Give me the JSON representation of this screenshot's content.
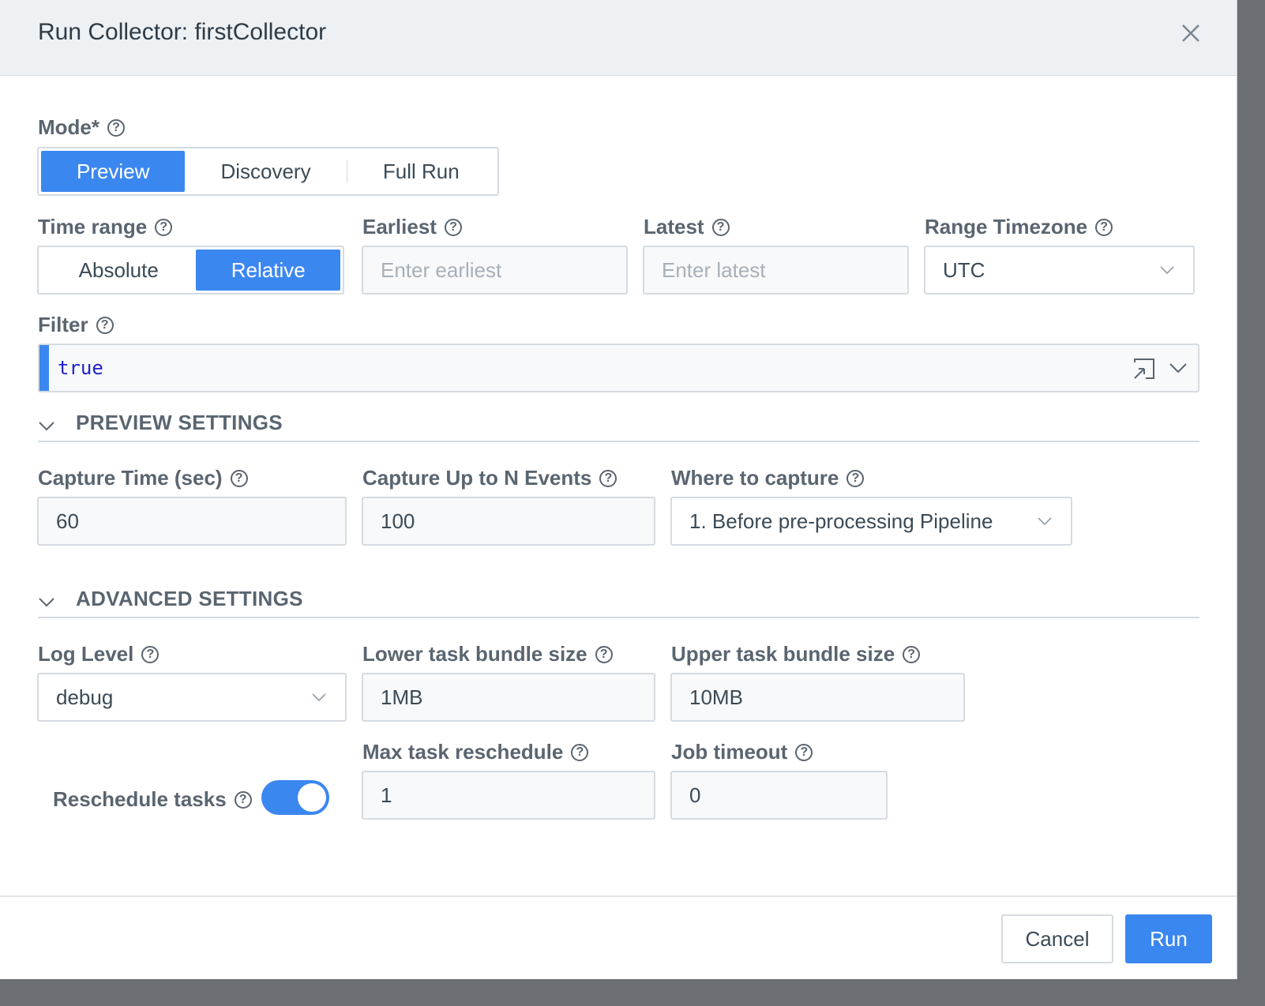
{
  "modal": {
    "title": "Run Collector: firstCollector"
  },
  "mode": {
    "label": "Mode*",
    "options": [
      "Preview",
      "Discovery",
      "Full Run"
    ],
    "selected": "Preview"
  },
  "time_range": {
    "label": "Time range",
    "options": [
      "Absolute",
      "Relative"
    ],
    "selected": "Relative"
  },
  "earliest": {
    "label": "Earliest",
    "placeholder": "Enter earliest",
    "value": ""
  },
  "latest": {
    "label": "Latest",
    "placeholder": "Enter latest",
    "value": ""
  },
  "range_timezone": {
    "label": "Range Timezone",
    "value": "UTC"
  },
  "filter": {
    "label": "Filter",
    "value": "true"
  },
  "preview_settings": {
    "title": "PREVIEW SETTINGS",
    "capture_time": {
      "label": "Capture Time (sec)",
      "value": "60"
    },
    "capture_events": {
      "label": "Capture Up to N Events",
      "value": "100"
    },
    "where_to_capture": {
      "label": "Where to capture",
      "value": "1. Before pre-processing Pipeline"
    }
  },
  "advanced_settings": {
    "title": "ADVANCED SETTINGS",
    "log_level": {
      "label": "Log Level",
      "value": "debug"
    },
    "lower_bundle": {
      "label": "Lower task bundle size",
      "value": "1MB"
    },
    "upper_bundle": {
      "label": "Upper task bundle size",
      "value": "10MB"
    },
    "reschedule_tasks": {
      "label": "Reschedule tasks",
      "enabled": true
    },
    "max_reschedule": {
      "label": "Max task reschedule",
      "value": "1"
    },
    "job_timeout": {
      "label": "Job timeout",
      "value": "0"
    }
  },
  "footer": {
    "cancel_label": "Cancel",
    "run_label": "Run"
  },
  "colors": {
    "accent": "#3b87f0",
    "header_bg": "#edf1f4",
    "input_bg": "#f7f9fb",
    "border": "#d5dbe0"
  }
}
